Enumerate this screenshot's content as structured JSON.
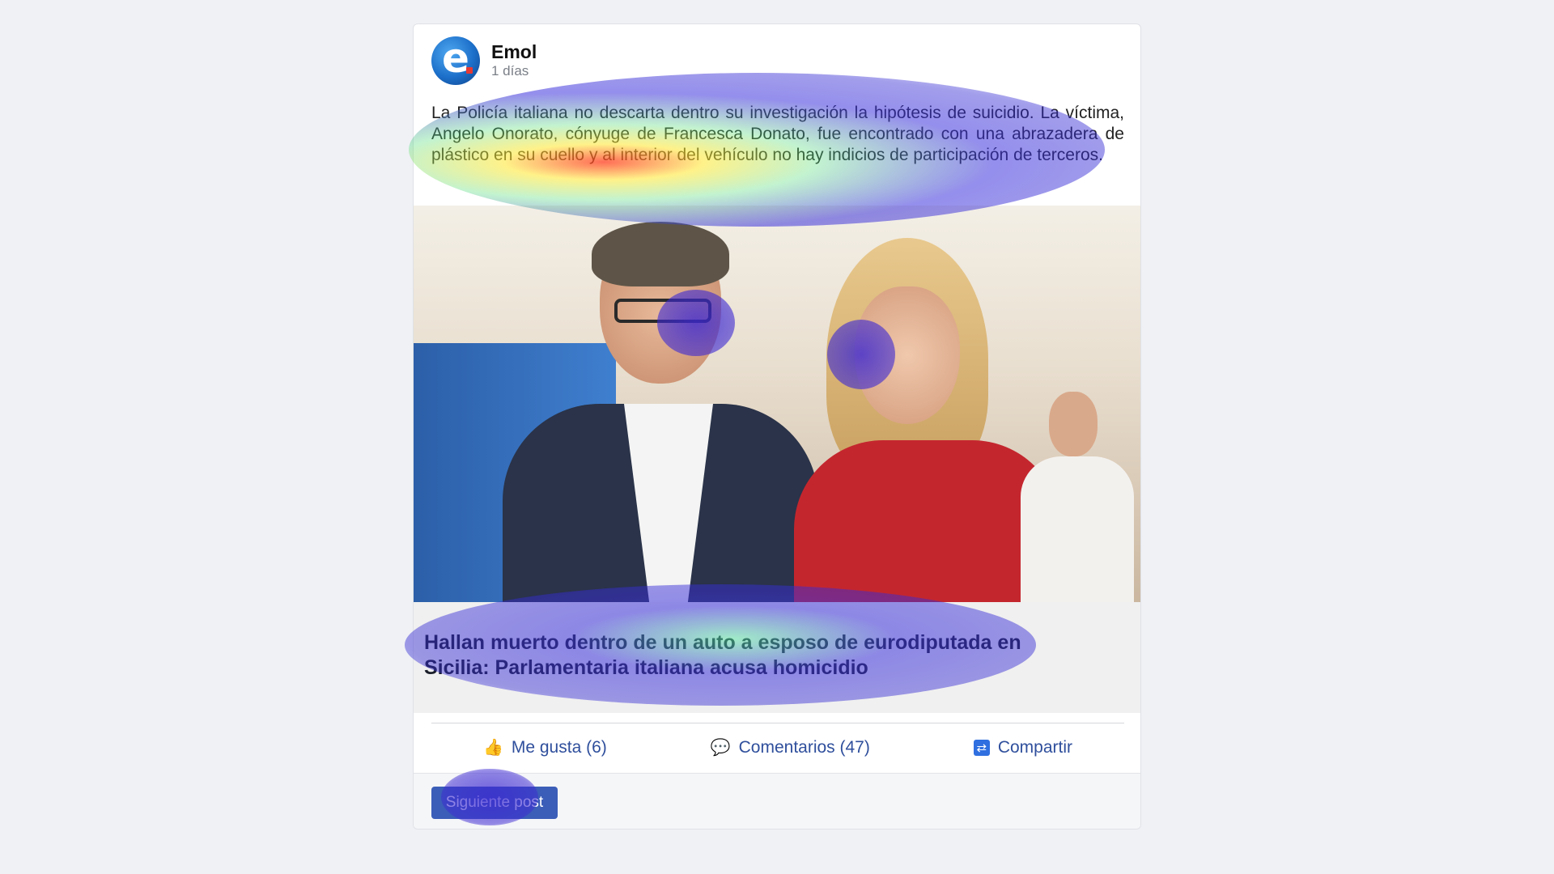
{
  "post": {
    "author": "Emol",
    "time": "1 días",
    "logo_letter": "e",
    "text": "La Policía italiana no descarta dentro su investigación la hipótesis de suicidio. La víctima, Angelo Onorato, cónyuge de Francesca Donato, fue encontrado con una abrazadera de plástico en su cuello y al interior del vehículo no hay indicios de participación de terceros.",
    "link_title": "Hallan muerto dentro de un auto a esposo de eurodiputada en Sicilia: Parlamentaria italiana acusa homicidio"
  },
  "actions": {
    "like": {
      "label": "Me gusta (6)",
      "icon": "thumbs-up-icon"
    },
    "comment": {
      "label": "Comentarios (47)",
      "icon": "speech-bubble-icon"
    },
    "share": {
      "label": "Compartir",
      "icon": "share-icon"
    }
  },
  "footer": {
    "next_button": "Siguiente post"
  },
  "colors": {
    "background": "#eff1f5",
    "action_text": "#2f4f9c",
    "next_button": "#3b5eb8",
    "heatmap_cool": "#3a2fd6",
    "heatmap_hot": "#ff3b1f"
  }
}
